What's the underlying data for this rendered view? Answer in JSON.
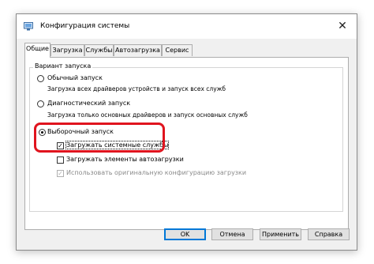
{
  "window": {
    "title": "Конфигурация системы",
    "close_glyph": "✕"
  },
  "tabs": [
    {
      "label": "Общие",
      "active": true
    },
    {
      "label": "Загрузка",
      "active": false
    },
    {
      "label": "Службы",
      "active": false
    },
    {
      "label": "Автозагрузка",
      "active": false
    },
    {
      "label": "Сервис",
      "active": false
    }
  ],
  "startup": {
    "group_label": "Вариант запуска",
    "options": [
      {
        "label": "Обычный запуск",
        "description": "Загрузка всех драйверов устройств и запуск всех служб",
        "checked": false
      },
      {
        "label": "Диагностический запуск",
        "description": "Загрузка только основных драйверов и запуск основных служб",
        "checked": false
      },
      {
        "label": "Выборочный запуск",
        "description": "",
        "checked": true
      }
    ],
    "selective": {
      "load_services": {
        "label": "Загружать системные службы",
        "checked": true,
        "enabled": true
      },
      "load_startup": {
        "label": "Загружать элементы автозагрузки",
        "checked": false,
        "enabled": true
      },
      "use_original": {
        "label": "Использовать оригинальную конфигурацию загрузки",
        "checked": true,
        "enabled": false
      }
    }
  },
  "buttons": {
    "ok": "OK",
    "cancel": "Отмена",
    "apply": "Применить",
    "help": "Справка"
  },
  "colors": {
    "highlight": "#e0141e",
    "default_button": "#0078d7"
  }
}
